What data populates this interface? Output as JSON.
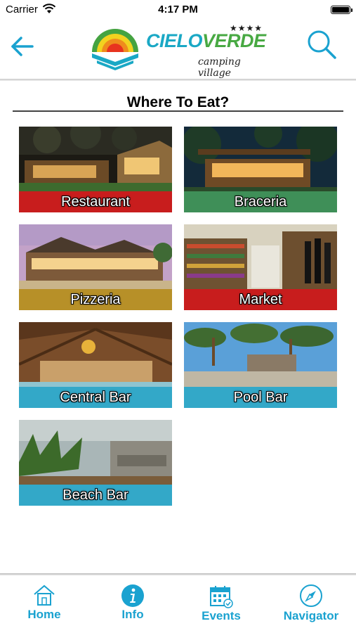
{
  "status_bar": {
    "carrier": "Carrier",
    "time": "4:17 PM"
  },
  "header": {
    "logo": {
      "name_part1": "CIELO",
      "name_part2": "VERDE",
      "stars": "★★★★",
      "tagline": "camping village"
    },
    "back_icon": "back-arrow-icon",
    "search_icon": "search-icon"
  },
  "page": {
    "title": "Where To Eat?"
  },
  "tiles": [
    {
      "label": "Restaurant",
      "band_color": "#c81d1d"
    },
    {
      "label": "Braceria",
      "band_color": "#3f8f58"
    },
    {
      "label": "Pizzeria",
      "band_color": "#b79028"
    },
    {
      "label": "Market",
      "band_color": "#c81d1d"
    },
    {
      "label": "Central Bar",
      "band_color": "#33a8c8"
    },
    {
      "label": "Pool Bar",
      "band_color": "#33a8c8"
    },
    {
      "label": "Beach Bar",
      "band_color": "#33a8c8"
    }
  ],
  "tab_bar": {
    "tabs": [
      {
        "label": "Home",
        "icon": "home-icon"
      },
      {
        "label": "Info",
        "icon": "info-icon"
      },
      {
        "label": "Events",
        "icon": "calendar-icon"
      },
      {
        "label": "Navigator",
        "icon": "compass-icon"
      }
    ]
  },
  "colors": {
    "accent": "#1aa2d0",
    "brand_blue": "#1aa8c5",
    "brand_green": "#48a943"
  }
}
